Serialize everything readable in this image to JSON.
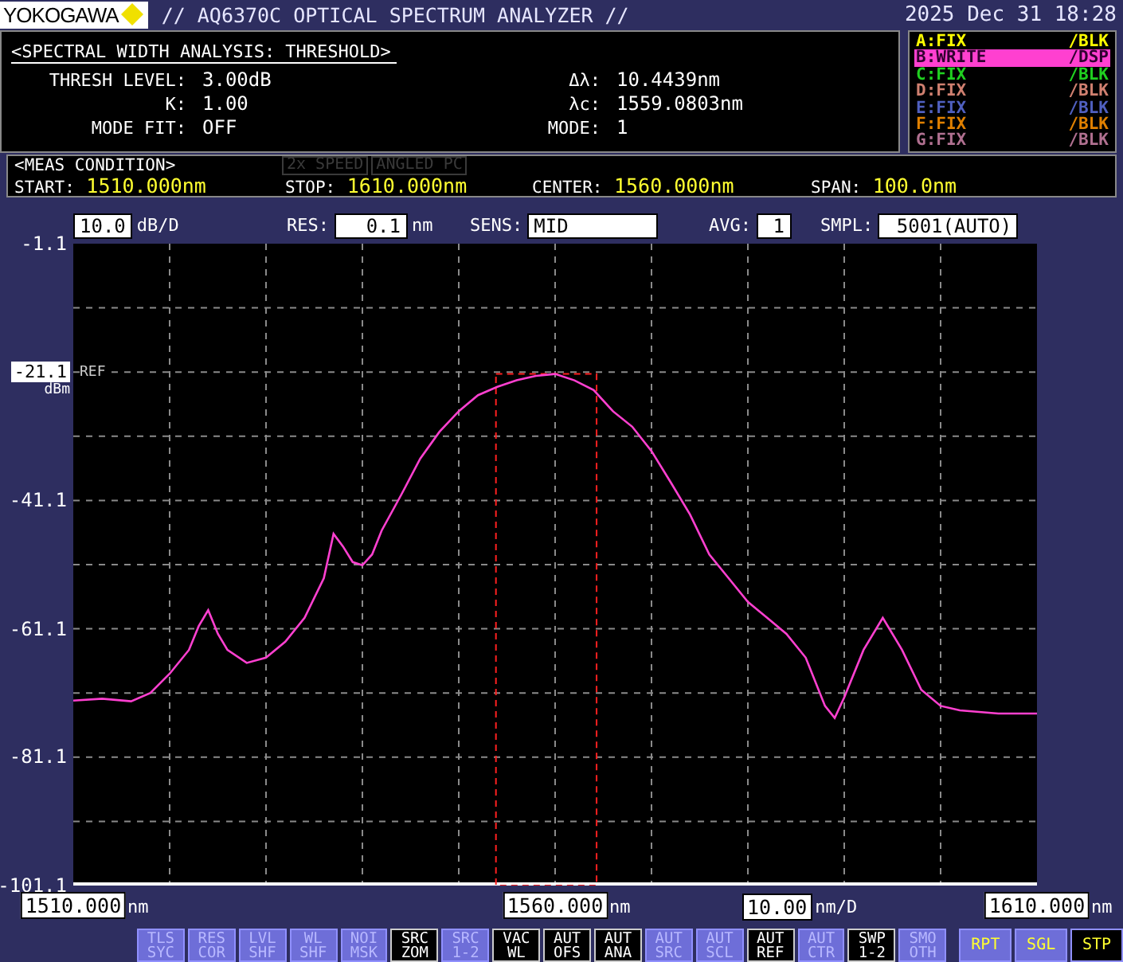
{
  "header": {
    "logo": "YOKOGAWA",
    "title": "// AQ6370C OPTICAL SPECTRUM ANALYZER //",
    "datetime": "2025 Dec 31 18:28"
  },
  "analysis": {
    "title": "<SPECTRAL WIDTH ANALYSIS: THRESHOLD>",
    "fields": [
      {
        "label": "THRESH LEVEL:",
        "value": "3.00dB",
        "label2": "Δλ:",
        "value2": "10.4439nm"
      },
      {
        "label": "K:",
        "value": "1.00",
        "label2": "λc:",
        "value2": "1559.0803nm"
      },
      {
        "label": "MODE FIT:",
        "value": "OFF",
        "label2": "MODE:",
        "value2": "1"
      }
    ]
  },
  "traces": [
    {
      "name": "A:FIX",
      "mode": "/BLK",
      "color": "#ffff00",
      "selected": false
    },
    {
      "name": "B:WRITE",
      "mode": "/DSP",
      "color": "#ff40d0",
      "selected": true
    },
    {
      "name": "C:FIX",
      "mode": "/BLK",
      "color": "#20d020",
      "selected": false
    },
    {
      "name": "D:FIX",
      "mode": "/BLK",
      "color": "#d08070",
      "selected": false
    },
    {
      "name": "E:FIX",
      "mode": "/BLK",
      "color": "#5060c0",
      "selected": false
    },
    {
      "name": "F:FIX",
      "mode": "/BLK",
      "color": "#e08000",
      "selected": false
    },
    {
      "name": "G:FIX",
      "mode": "/BLK",
      "color": "#b07090",
      "selected": false
    }
  ],
  "meas_condition": {
    "title": "<MEAS CONDITION>",
    "options": [
      {
        "label": "2x SPEED",
        "disabled": true
      },
      {
        "label": "ANGLED PC",
        "disabled": true
      }
    ],
    "params": [
      {
        "label": "START:",
        "value": "1510.000nm"
      },
      {
        "label": "STOP:",
        "value": "1610.000nm"
      },
      {
        "label": "CENTER:",
        "value": "1560.000nm"
      },
      {
        "label": "SPAN:",
        "value": "100.0nm"
      }
    ]
  },
  "settings": [
    {
      "value": "10.0",
      "unit": "dB/D"
    },
    {
      "label": "RES:",
      "value": "0.1",
      "unit": "nm"
    },
    {
      "label": "SENS:",
      "value": "MID"
    },
    {
      "label": "AVG:",
      "value": "1"
    },
    {
      "label": "SMPL:",
      "value": "5001(AUTO)"
    }
  ],
  "ref_level": {
    "value": "-21.1",
    "label": "REF",
    "unit": "dBm"
  },
  "chart_data": {
    "type": "line",
    "xlim": [
      1510,
      1610
    ],
    "grid": true,
    "ylim": [
      -101.1,
      -1.1
    ],
    "yticks": [
      {
        "value": -1.1,
        "label": "-1.1"
      },
      {
        "value": -41.1,
        "label": "-41.1"
      },
      {
        "value": -61.1,
        "label": "-61.1"
      },
      {
        "value": -81.1,
        "label": "-81.1"
      },
      {
        "value": -101.1,
        "label": "-101.1"
      }
    ],
    "x": [
      1510,
      1513,
      1516,
      1518,
      1520,
      1522,
      1523,
      1524,
      1525,
      1526,
      1528,
      1530,
      1532,
      1534,
      1536,
      1537,
      1538,
      1539,
      1540,
      1541,
      1542,
      1544,
      1546,
      1548,
      1550,
      1552,
      1554,
      1556,
      1558,
      1560,
      1562,
      1564,
      1566,
      1568,
      1570,
      1572,
      1574,
      1576,
      1578,
      1580,
      1582,
      1584,
      1586,
      1588,
      1589,
      1590,
      1592,
      1594,
      1596,
      1598,
      1600,
      1602,
      1606,
      1610
    ],
    "xticks": [
      {
        "value": 1510,
        "label": "1510.000"
      },
      {
        "value": 1560,
        "label": "1560.000"
      },
      {
        "value": 1610,
        "label": "1610.000"
      }
    ],
    "series": [
      {
        "color": "#ff40d0",
        "values": [
          -72.3,
          -72.0,
          -72.4,
          -71.1,
          -68.1,
          -64.4,
          -60.7,
          -58.2,
          -61.9,
          -64.4,
          -66.4,
          -65.6,
          -63.1,
          -59.4,
          -53.2,
          -46.3,
          -48.3,
          -50.7,
          -51.2,
          -49.5,
          -45.8,
          -40.3,
          -34.6,
          -30.4,
          -27.2,
          -24.7,
          -23.4,
          -22.4,
          -21.7,
          -21.4,
          -22.4,
          -23.9,
          -27.2,
          -29.6,
          -33.4,
          -38.3,
          -43.3,
          -49.5,
          -53.2,
          -56.9,
          -59.4,
          -61.9,
          -65.6,
          -73.1,
          -75.0,
          -71.8,
          -64.4,
          -59.4,
          -64.4,
          -70.6,
          -73.1,
          -73.8,
          -74.3,
          -74.3
        ]
      }
    ]
  },
  "x_tick_units": [
    "nm",
    "nm",
    "nm"
  ],
  "x_division": {
    "value": "10.00",
    "unit": "nm/D"
  },
  "soft_keys": [
    {
      "lines": [
        "TLS",
        "SYC"
      ],
      "kind": "function",
      "active": false
    },
    {
      "lines": [
        "RES",
        "COR"
      ],
      "kind": "function",
      "active": false
    },
    {
      "lines": [
        "LVL",
        "SHF"
      ],
      "kind": "function",
      "active": false
    },
    {
      "lines": [
        "WL",
        "SHF"
      ],
      "kind": "function",
      "active": false
    },
    {
      "lines": [
        "NOI",
        "MSK"
      ],
      "kind": "function",
      "active": false
    },
    {
      "lines": [
        "SRC",
        "ZOM"
      ],
      "kind": "function",
      "active": true
    },
    {
      "lines": [
        "SRC",
        "1-2"
      ],
      "kind": "function",
      "active": false
    },
    {
      "lines": [
        "VAC",
        "WL"
      ],
      "kind": "function",
      "active": true
    },
    {
      "lines": [
        "AUT",
        "OFS"
      ],
      "kind": "function",
      "active": true
    },
    {
      "lines": [
        "AUT",
        "ANA"
      ],
      "kind": "function",
      "active": true
    },
    {
      "lines": [
        "AUT",
        "SRC"
      ],
      "kind": "function",
      "active": false
    },
    {
      "lines": [
        "AUT",
        "SCL"
      ],
      "kind": "function",
      "active": false
    },
    {
      "lines": [
        "AUT",
        "REF"
      ],
      "kind": "function",
      "active": true
    },
    {
      "lines": [
        "AUT",
        "CTR"
      ],
      "kind": "function",
      "active": false
    },
    {
      "lines": [
        "SWP",
        "1-2"
      ],
      "kind": "function",
      "active": true
    },
    {
      "lines": [
        "SMO",
        "OTH"
      ],
      "kind": "function",
      "active": false
    },
    {
      "lines": [
        "RPT"
      ],
      "kind": "sweep",
      "active": false
    },
    {
      "lines": [
        "SGL"
      ],
      "kind": "sweep",
      "active": false
    },
    {
      "lines": [
        "STP"
      ],
      "kind": "sweep",
      "active": true
    }
  ]
}
